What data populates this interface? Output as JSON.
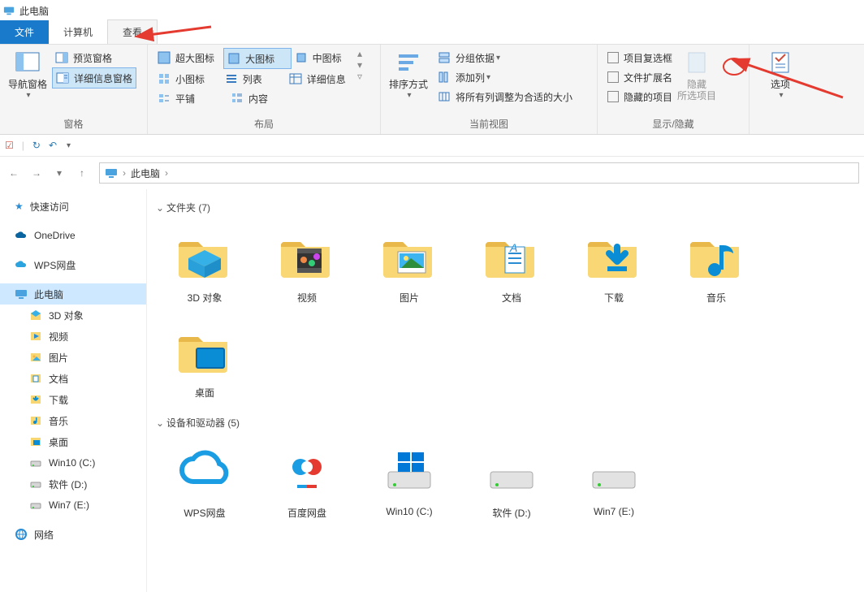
{
  "window": {
    "title": "此电脑"
  },
  "tabs": {
    "file": "文件",
    "computer": "计算机",
    "view": "查看"
  },
  "ribbon": {
    "panes": {
      "label": "窗格",
      "nav_pane": "导航窗格",
      "preview_pane": "预览窗格",
      "details_pane": "详细信息窗格"
    },
    "layout": {
      "label": "布局",
      "extra_large": "超大图标",
      "large": "大图标",
      "medium": "中图标",
      "small": "小图标",
      "list": "列表",
      "details": "详细信息",
      "tiles": "平铺",
      "content": "内容"
    },
    "current_view": {
      "label": "当前视图",
      "sort_by": "排序方式",
      "group_by": "分组依据",
      "add_columns": "添加列",
      "size_all_columns": "将所有列调整为合适的大小"
    },
    "show_hide": {
      "label": "显示/隐藏",
      "item_checkboxes": "项目复选框",
      "file_ext": "文件扩展名",
      "hidden_items": "隐藏的项目",
      "hide_selected": "隐藏\n所选项目"
    },
    "options": {
      "label": "选项"
    }
  },
  "breadcrumb": {
    "root": "此电脑"
  },
  "tree": {
    "quick_access": "快速访问",
    "onedrive": "OneDrive",
    "wps": "WPS网盘",
    "this_pc": "此电脑",
    "children": [
      "3D 对象",
      "视频",
      "图片",
      "文档",
      "下载",
      "音乐",
      "桌面",
      "Win10 (C:)",
      "软件 (D:)",
      "Win7 (E:)"
    ],
    "network": "网络"
  },
  "content": {
    "folders_header": "文件夹 (7)",
    "folders": [
      "3D 对象",
      "视频",
      "图片",
      "文档",
      "下载",
      "音乐",
      "桌面"
    ],
    "devices_header": "设备和驱动器 (5)",
    "devices": [
      "WPS网盘",
      "百度网盘",
      "Win10 (C:)",
      "软件 (D:)",
      "Win7 (E:)"
    ]
  }
}
